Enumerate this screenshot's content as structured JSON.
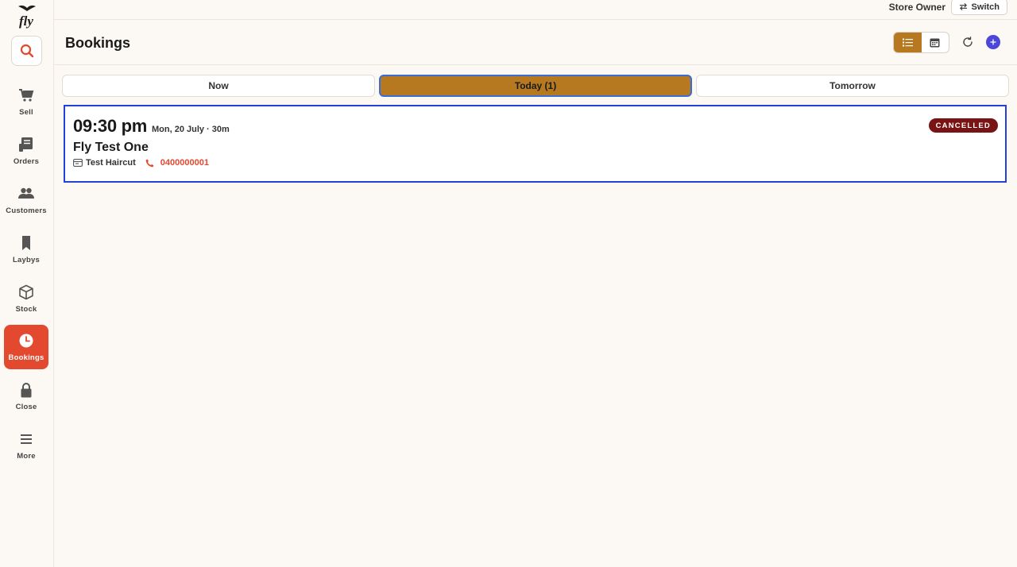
{
  "app": {
    "logo_text": "fly"
  },
  "topbar": {
    "user_role": "Store Owner",
    "switch_label": "Switch"
  },
  "header": {
    "title": "Bookings"
  },
  "sidebar": {
    "items": [
      {
        "label": "Sell",
        "icon": "cart-icon"
      },
      {
        "label": "Orders",
        "icon": "receipt-icon"
      },
      {
        "label": "Customers",
        "icon": "users-icon"
      },
      {
        "label": "Laybys",
        "icon": "bookmark-icon"
      },
      {
        "label": "Stock",
        "icon": "box-icon"
      },
      {
        "label": "Bookings",
        "icon": "clock-icon",
        "active": true
      },
      {
        "label": "Close",
        "icon": "lock-icon"
      },
      {
        "label": "More",
        "icon": "menu-icon"
      }
    ]
  },
  "view_toggle": {
    "active": "list",
    "options": [
      "list-icon",
      "calendar-icon"
    ]
  },
  "tabs": [
    {
      "label": "Now"
    },
    {
      "label": "Today (1)",
      "active": true
    },
    {
      "label": "Tomorrow"
    }
  ],
  "bookings": [
    {
      "time": "09:30 pm",
      "date": "Mon, 20 July",
      "duration": "· 30m",
      "customer": "Fly Test One",
      "service": "Test Haircut",
      "phone": "0400000001",
      "status": "CANCELLED"
    }
  ],
  "colors": {
    "accent": "#b7791f",
    "active_nav": "#e2492f",
    "primary": "#4c46d9",
    "status_cancelled": "#7a1414",
    "card_border": "#2340d8"
  }
}
